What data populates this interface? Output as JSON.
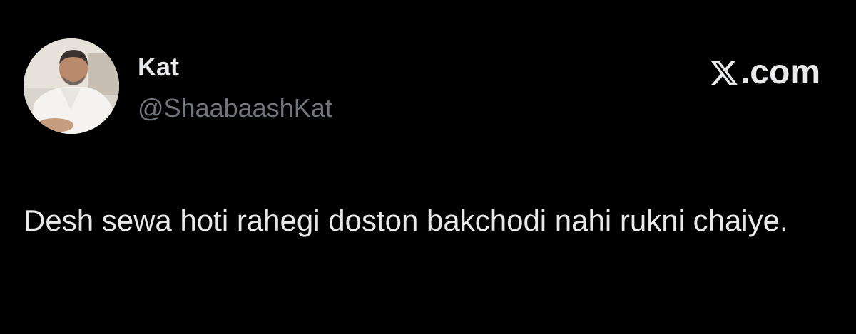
{
  "user": {
    "display_name": "Kat",
    "handle": "@ShaabaashKat"
  },
  "brand": {
    "logo_icon": "x-logo-icon",
    "domain": ".com"
  },
  "tweet": {
    "text": "Desh sewa hoti rahegi doston bakchodi nahi rukni chaiye."
  },
  "colors": {
    "background": "#000000",
    "primary_text": "#e7e9ea",
    "secondary_text": "#71767b"
  }
}
